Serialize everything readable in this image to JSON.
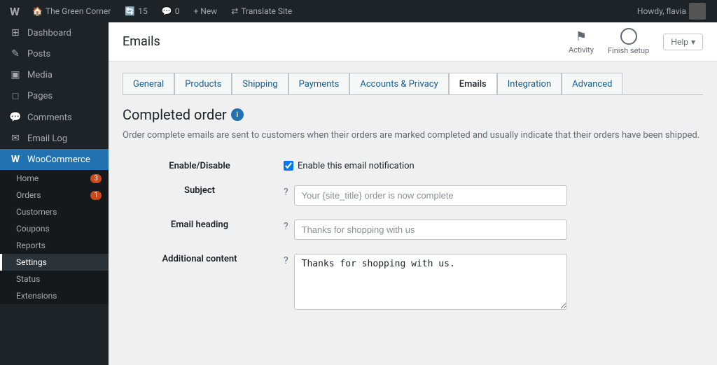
{
  "adminbar": {
    "logo": "W",
    "site_name": "The Green Corner",
    "updates_count": "15",
    "comments_count": "0",
    "new_label": "+ New",
    "translate_label": "Translate Site",
    "howdy_label": "Howdy, flavia"
  },
  "sidebar": {
    "dashboard_label": "Dashboard",
    "posts_label": "Posts",
    "media_label": "Media",
    "pages_label": "Pages",
    "comments_label": "Comments",
    "email_log_label": "Email Log",
    "woocommerce_label": "WooCommerce",
    "submenu": {
      "home_label": "Home",
      "home_badge": "3",
      "orders_label": "Orders",
      "orders_badge": "1",
      "customers_label": "Customers",
      "coupons_label": "Coupons",
      "reports_label": "Reports",
      "settings_label": "Settings",
      "status_label": "Status",
      "extensions_label": "Extensions"
    }
  },
  "topbar": {
    "page_title": "Emails",
    "activity_label": "Activity",
    "finish_setup_label": "Finish setup",
    "help_label": "Help"
  },
  "tabs": [
    {
      "label": "General",
      "active": false
    },
    {
      "label": "Products",
      "active": false
    },
    {
      "label": "Shipping",
      "active": false
    },
    {
      "label": "Payments",
      "active": false
    },
    {
      "label": "Accounts & Privacy",
      "active": false
    },
    {
      "label": "Emails",
      "active": true
    },
    {
      "label": "Integration",
      "active": false
    },
    {
      "label": "Advanced",
      "active": false
    }
  ],
  "section": {
    "title": "Completed order",
    "description": "Order complete emails are sent to customers when their orders are marked completed and usually indicate that their orders have been shipped."
  },
  "form": {
    "enable_disable_label": "Enable/Disable",
    "enable_checkbox_label": "Enable this email notification",
    "subject_label": "Subject",
    "subject_placeholder": "Your {site_title} order is now complete",
    "email_heading_label": "Email heading",
    "email_heading_placeholder": "Thanks for shopping with us",
    "additional_content_label": "Additional content",
    "additional_content_value": "Thanks for shopping with us."
  },
  "icons": {
    "wp_logo": "W",
    "dashboard": "⊞",
    "posts": "✎",
    "media": "▣",
    "pages": "□",
    "comments": "💬",
    "email": "✉",
    "woo": "W",
    "flag": "⚑",
    "circle": "○",
    "question": "?",
    "info": "i",
    "chevron": "▾"
  }
}
